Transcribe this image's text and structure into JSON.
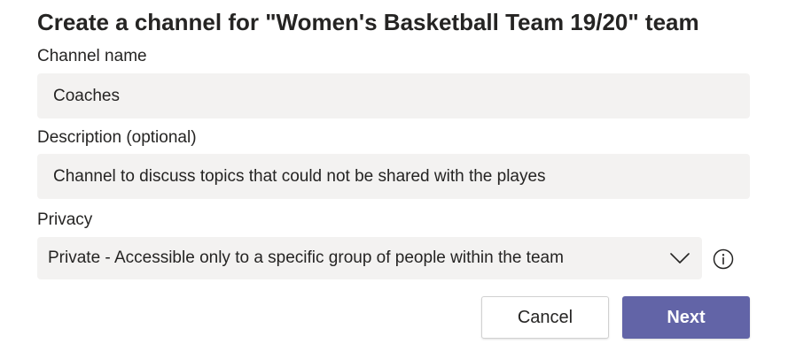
{
  "dialog": {
    "title": "Create a channel for \"Women's Basketball Team 19/20\" team"
  },
  "channel_name": {
    "label": "Channel name",
    "value": "Coaches"
  },
  "description": {
    "label": "Description (optional)",
    "value": "Channel to discuss topics that could not be shared with the playes"
  },
  "privacy": {
    "label": "Privacy",
    "selected": "Private - Accessible only to a specific group of people within the team",
    "icons": {
      "dropdown": "chevron-down-icon",
      "info": "info-icon"
    }
  },
  "buttons": {
    "cancel": "Cancel",
    "next": "Next"
  },
  "colors": {
    "accent": "#6264a7",
    "field_background": "#f3f2f1",
    "text": "#252423"
  }
}
